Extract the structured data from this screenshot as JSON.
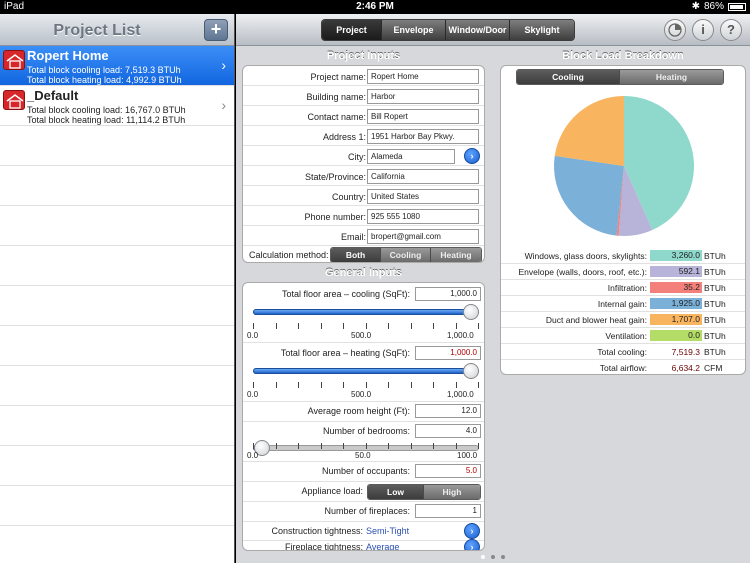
{
  "status": {
    "device": "iPad",
    "time": "2:46 PM",
    "battery": "86%"
  },
  "left": {
    "title": "Project List",
    "add_label": "+",
    "projects": [
      {
        "name": "Ropert Home",
        "cooling": "Total block cooling load: 7,519.3 BTUh",
        "heating": "Total block heating load: 4,992.9 BTUh"
      },
      {
        "name": "_Default",
        "cooling": "Total block cooling load: 16,767.0 BTUh",
        "heating": "Total block heating load: 11,114.2 BTUh"
      }
    ]
  },
  "tabs": [
    "Project",
    "Envelope",
    "Window/Door",
    "Skylight"
  ],
  "icons": {
    "chart": "pie-chart-icon",
    "info": "i",
    "help": "?"
  },
  "project_inputs": {
    "title": "Project Inputs",
    "fields": [
      {
        "label": "Project name:",
        "value": "Ropert Home"
      },
      {
        "label": "Building name:",
        "value": "Harbor"
      },
      {
        "label": "Contact name:",
        "value": "Bill Ropert"
      },
      {
        "label": "Address 1:",
        "value": "1951 Harbor Bay Pkwy."
      },
      {
        "label": "City:",
        "value": "Alameda"
      },
      {
        "label": "State/Province:",
        "value": "California"
      },
      {
        "label": "Country:",
        "value": "United States"
      },
      {
        "label": "Phone number:",
        "value": "925 555 1080"
      },
      {
        "label": "Email:",
        "value": "bropert@gmail.com"
      }
    ],
    "calc_label": "Calculation method:",
    "calc_options": [
      "Both",
      "Cooling",
      "Heating"
    ]
  },
  "general_inputs": {
    "title": "General Inputs",
    "cooling_area_label": "Total floor area – cooling (SqFt):",
    "cooling_area": "1,000.0",
    "heating_area_label": "Total floor area – heating (SqFt):",
    "heating_area": "1,000.0",
    "slider_area": {
      "min": "0.0",
      "mid": "500.0",
      "max": "1,000.0"
    },
    "cooling_slider_fraction": 1.0,
    "heating_slider_fraction": 1.0,
    "room_height_label": "Average room height (Ft):",
    "room_height": "12.0",
    "bedrooms_label": "Number of bedrooms:",
    "bedrooms": "4.0",
    "slider_bed": {
      "min": "0.0",
      "mid": "50.0",
      "max": "100.0"
    },
    "bedroom_slider_fraction": 0.04,
    "occupants_label": "Number of occupants:",
    "occupants": "5.0",
    "appliance_label": "Appliance load:",
    "appliance_options": [
      "Low",
      "High"
    ],
    "fireplaces_label": "Number of fireplaces:",
    "fireplaces": "1",
    "tightness_label": "Construction tightness:",
    "tightness_value": "Semi-Tight",
    "fp_tightness_label": "Fireplace tightness:",
    "fp_tightness_value": "Average"
  },
  "breakdown": {
    "title": "Block Load Breakdown",
    "toggle": [
      "Cooling",
      "Heating"
    ],
    "total_cooling_label": "Total cooling:",
    "total_cooling": "7,519.3",
    "total_airflow_label": "Total airflow:",
    "total_airflow": "6,634.2",
    "unit_btuh": "BTUh",
    "unit_cfm": "CFM"
  },
  "chart_data": {
    "type": "pie",
    "categories": [
      "Windows, glass doors, skylights:",
      "Envelope (walls, doors, roof, etc.):",
      "Infiltration:",
      "Internal gain:",
      "Duct and blower heat gain:",
      "Ventilation:"
    ],
    "values": [
      3260.0,
      592.1,
      35.2,
      1925.0,
      1707.0,
      0.0
    ],
    "labels": [
      "3,260.0",
      "592.1",
      "35.2",
      "1,925.0",
      "1,707.0",
      "0.0"
    ],
    "colors": [
      "#8fd9cc",
      "#b7b3d9",
      "#f3807a",
      "#7bb0d8",
      "#f9b45f",
      "#b4dd68"
    ]
  }
}
